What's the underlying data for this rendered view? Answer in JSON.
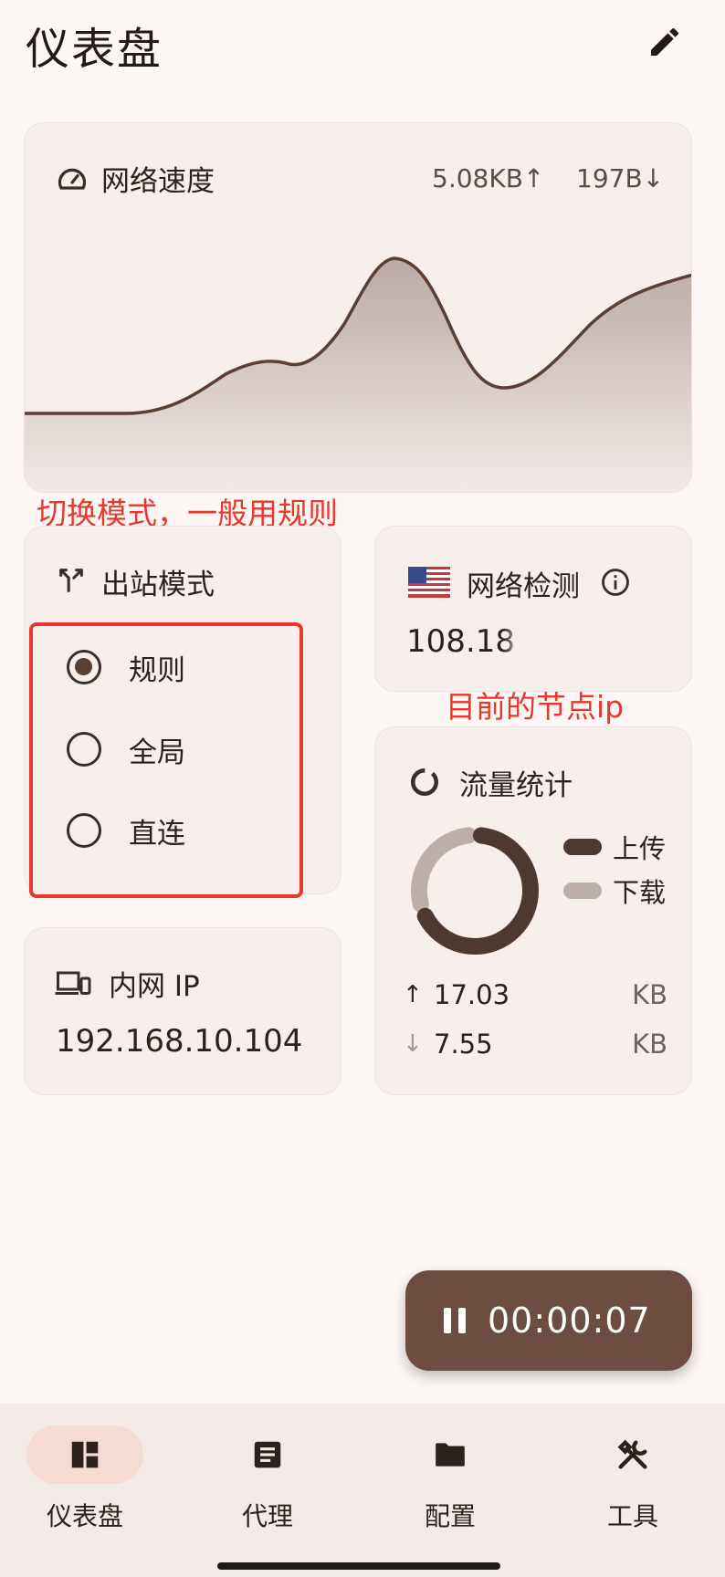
{
  "header": {
    "title": "仪表盘",
    "edit_icon": "pencil-icon"
  },
  "speed_card": {
    "title": "网络速度",
    "icon": "speedometer-icon",
    "upload": "5.08KB↑",
    "download": "197B↓",
    "line_color": "#5a3f35"
  },
  "annotations": {
    "mode_hint": "切换模式，一般用规则",
    "node_hint": "目前的节点ip"
  },
  "mode_card": {
    "title": "出站模式",
    "icon": "fork-arrow-icon",
    "options": [
      {
        "label": "规则",
        "selected": true
      },
      {
        "label": "全局",
        "selected": false
      },
      {
        "label": "直连",
        "selected": false
      }
    ]
  },
  "detect_card": {
    "title": "网络检测",
    "flag_icon": "us-flag-icon",
    "info_icon": "info-icon",
    "ip": "108.18"
  },
  "traffic_card": {
    "title": "流量统计",
    "icon": "donut-icon",
    "legend": [
      {
        "label": "上传",
        "color": "#4e3832"
      },
      {
        "label": "下载",
        "color": "#bcaea9"
      }
    ],
    "upload_value": "17.03",
    "upload_unit": "KB",
    "download_value": "7.55",
    "download_unit": "KB",
    "upload_fraction": 0.6928
  },
  "lan_card": {
    "title": "内网 IP",
    "icon": "devices-icon",
    "ip": "192.168.10.104"
  },
  "timer": {
    "icon": "pause-icon",
    "time": "00:00:07"
  },
  "bottom_nav": [
    {
      "label": "仪表盘",
      "icon": "dashboard-icon",
      "active": true
    },
    {
      "label": "代理",
      "icon": "article-icon",
      "active": false
    },
    {
      "label": "配置",
      "icon": "folder-icon",
      "active": false
    },
    {
      "label": "工具",
      "icon": "tools-icon",
      "active": false
    }
  ]
}
